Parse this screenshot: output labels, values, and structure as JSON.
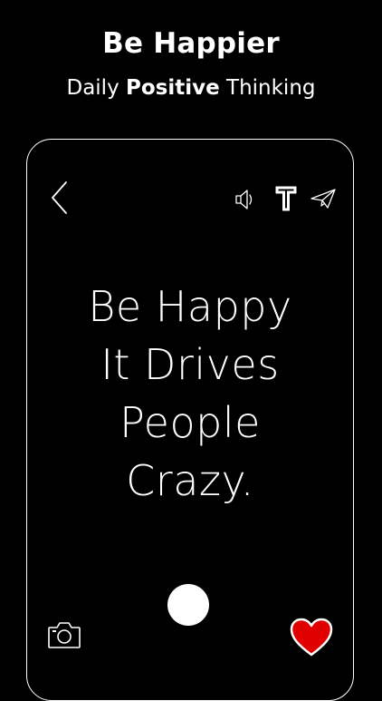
{
  "promo": {
    "title": "Be Happier",
    "subtitle_pre": "Daily ",
    "subtitle_bold": "Positive",
    "subtitle_post": " Thinking"
  },
  "toolbar": {
    "back_icon": "chevron-left-icon",
    "sound_icon": "speaker-icon",
    "font_icon": "text-font-icon",
    "share_icon": "paper-plane-icon"
  },
  "quote": {
    "lines": [
      "Be Happy",
      "It Drives",
      "People",
      "Crazy."
    ]
  },
  "bottom_bar": {
    "camera_icon": "camera-icon",
    "capture_icon": "capture-circle-icon",
    "favorite_icon": "heart-icon"
  },
  "colors": {
    "background": "#000000",
    "foreground": "#ffffff",
    "heart": "#e00000"
  }
}
